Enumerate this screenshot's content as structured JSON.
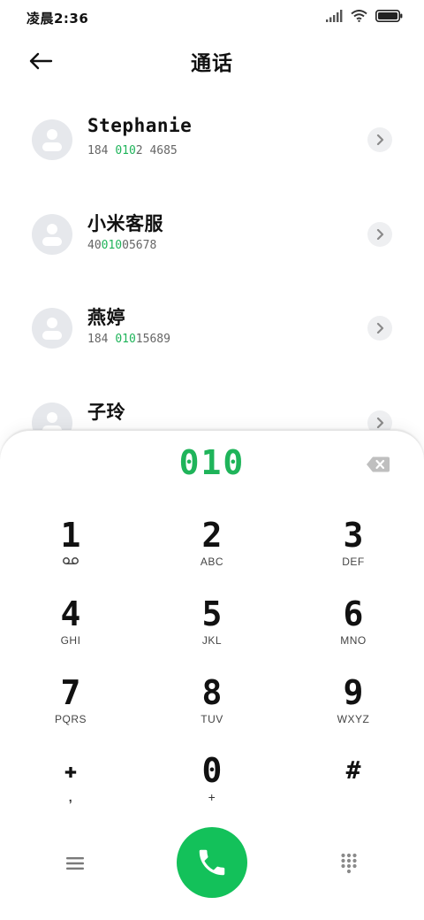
{
  "status_bar": {
    "time": "凌晨2:36"
  },
  "header": {
    "title": "通话"
  },
  "contacts": [
    {
      "name": "Stephanie",
      "number_prefix": "184 ",
      "number_match": "010",
      "number_suffix": "2 4685"
    },
    {
      "name": "小米客服",
      "number_prefix": "40",
      "number_match": "010",
      "number_suffix": "05678"
    },
    {
      "name": "燕婷",
      "number_prefix": "184 ",
      "number_match": "010",
      "number_suffix": "15689"
    },
    {
      "name": "子玲",
      "number_prefix": "",
      "number_match": "",
      "number_suffix": ""
    }
  ],
  "dialer": {
    "entered": "010",
    "keys": [
      {
        "digit": "1",
        "letters": ""
      },
      {
        "digit": "2",
        "letters": "ABC"
      },
      {
        "digit": "3",
        "letters": "DEF"
      },
      {
        "digit": "4",
        "letters": "GHI"
      },
      {
        "digit": "5",
        "letters": "JKL"
      },
      {
        "digit": "6",
        "letters": "MNO"
      },
      {
        "digit": "7",
        "letters": "PQRS"
      },
      {
        "digit": "8",
        "letters": "TUV"
      },
      {
        "digit": "9",
        "letters": "WXYZ"
      },
      {
        "digit": "✚",
        "letters": ","
      },
      {
        "digit": "0",
        "letters": "+"
      },
      {
        "digit": "#",
        "letters": ""
      }
    ]
  },
  "icons": {
    "back": "arrow-left-icon",
    "chevron": "chevron-right-icon",
    "backspace": "backspace-icon",
    "voicemail": "voicemail-icon",
    "menu": "menu-icon",
    "call": "phone-icon",
    "keypad": "dialpad-icon"
  },
  "colors": {
    "accent_green": "#1fb45a",
    "call_button": "#13c15a",
    "avatar_bg": "#e6e8ec"
  }
}
